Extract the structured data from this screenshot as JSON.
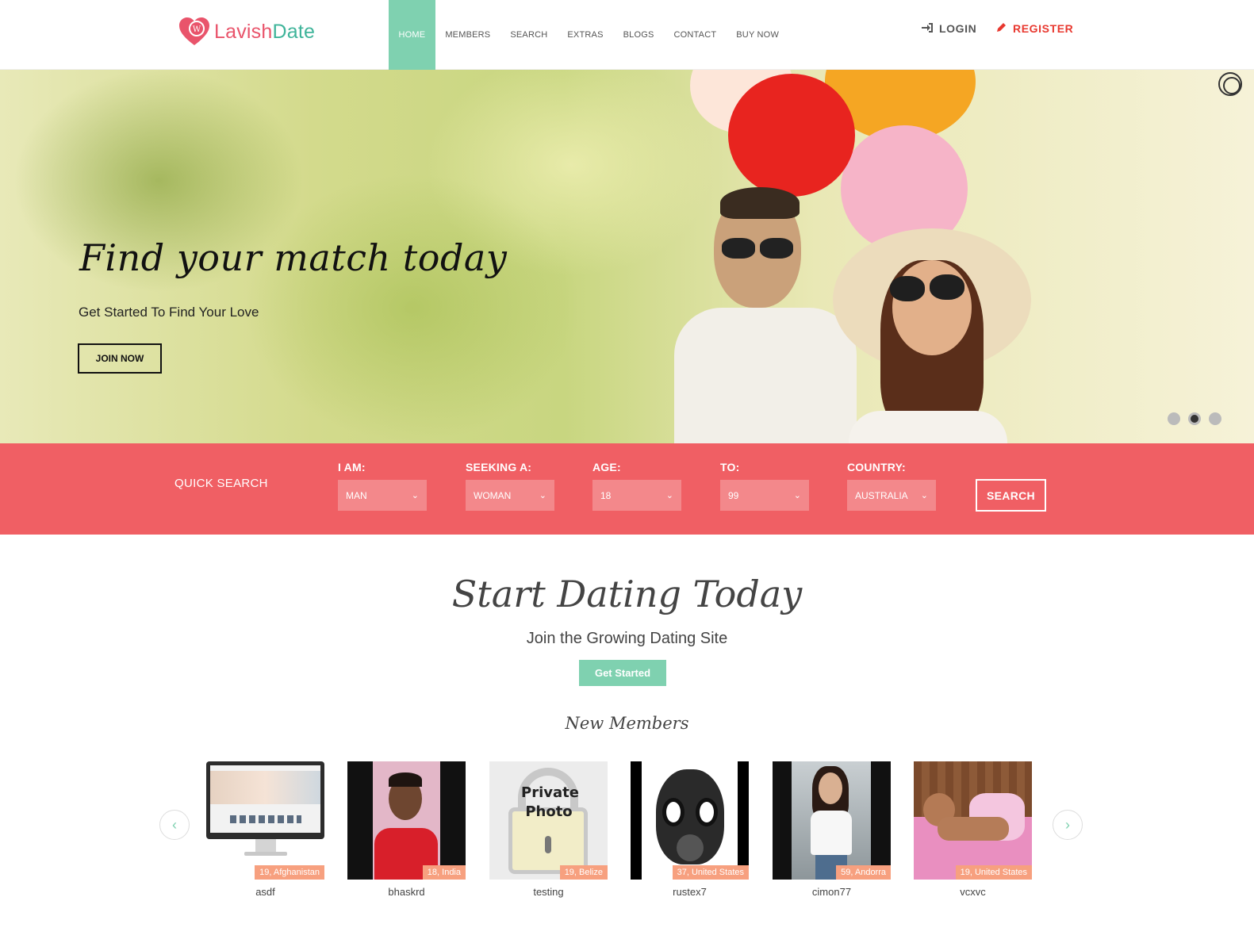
{
  "brand": {
    "part1": "Lavish",
    "part2": "Date"
  },
  "nav": [
    "HOME",
    "MEMBERS",
    "SEARCH",
    "EXTRAS",
    "BLOGS",
    "CONTACT",
    "BUY NOW"
  ],
  "auth": {
    "login": "LOGIN",
    "register": "REGISTER"
  },
  "hero": {
    "title": "Find your match today",
    "subtitle": "Get Started To Find Your Love",
    "button": "JOIN NOW",
    "active_slide": 2,
    "slide_count": 3
  },
  "quick_search": {
    "title": "QUICK SEARCH",
    "fields": [
      {
        "label": "I AM:",
        "value": "MAN"
      },
      {
        "label": "SEEKING A:",
        "value": "WOMAN"
      },
      {
        "label": "AGE:",
        "value": "18"
      },
      {
        "label": "TO:",
        "value": "99"
      },
      {
        "label": "COUNTRY:",
        "value": "AUSTRALIA"
      }
    ],
    "button": "SEARCH"
  },
  "main": {
    "title": "Start Dating Today",
    "subtitle": "Join the Growing Dating Site",
    "button": "Get Started",
    "members_title": "New Members"
  },
  "members": [
    {
      "name": "asdf",
      "badge": "19, Afghanistan"
    },
    {
      "name": "bhaskrd",
      "badge": "18, India"
    },
    {
      "name": "testing",
      "badge": "19, Belize",
      "private_text": "Private Photo"
    },
    {
      "name": "rustex7",
      "badge": "37, United States"
    },
    {
      "name": "cimon77",
      "badge": "59, Andorra"
    },
    {
      "name": "vcxvc",
      "badge": "19, United States"
    }
  ],
  "colors": {
    "accent_green": "#7fd1b0",
    "accent_red": "#f05f64",
    "register_red": "#e8382f",
    "badge": "#f7a07f"
  }
}
